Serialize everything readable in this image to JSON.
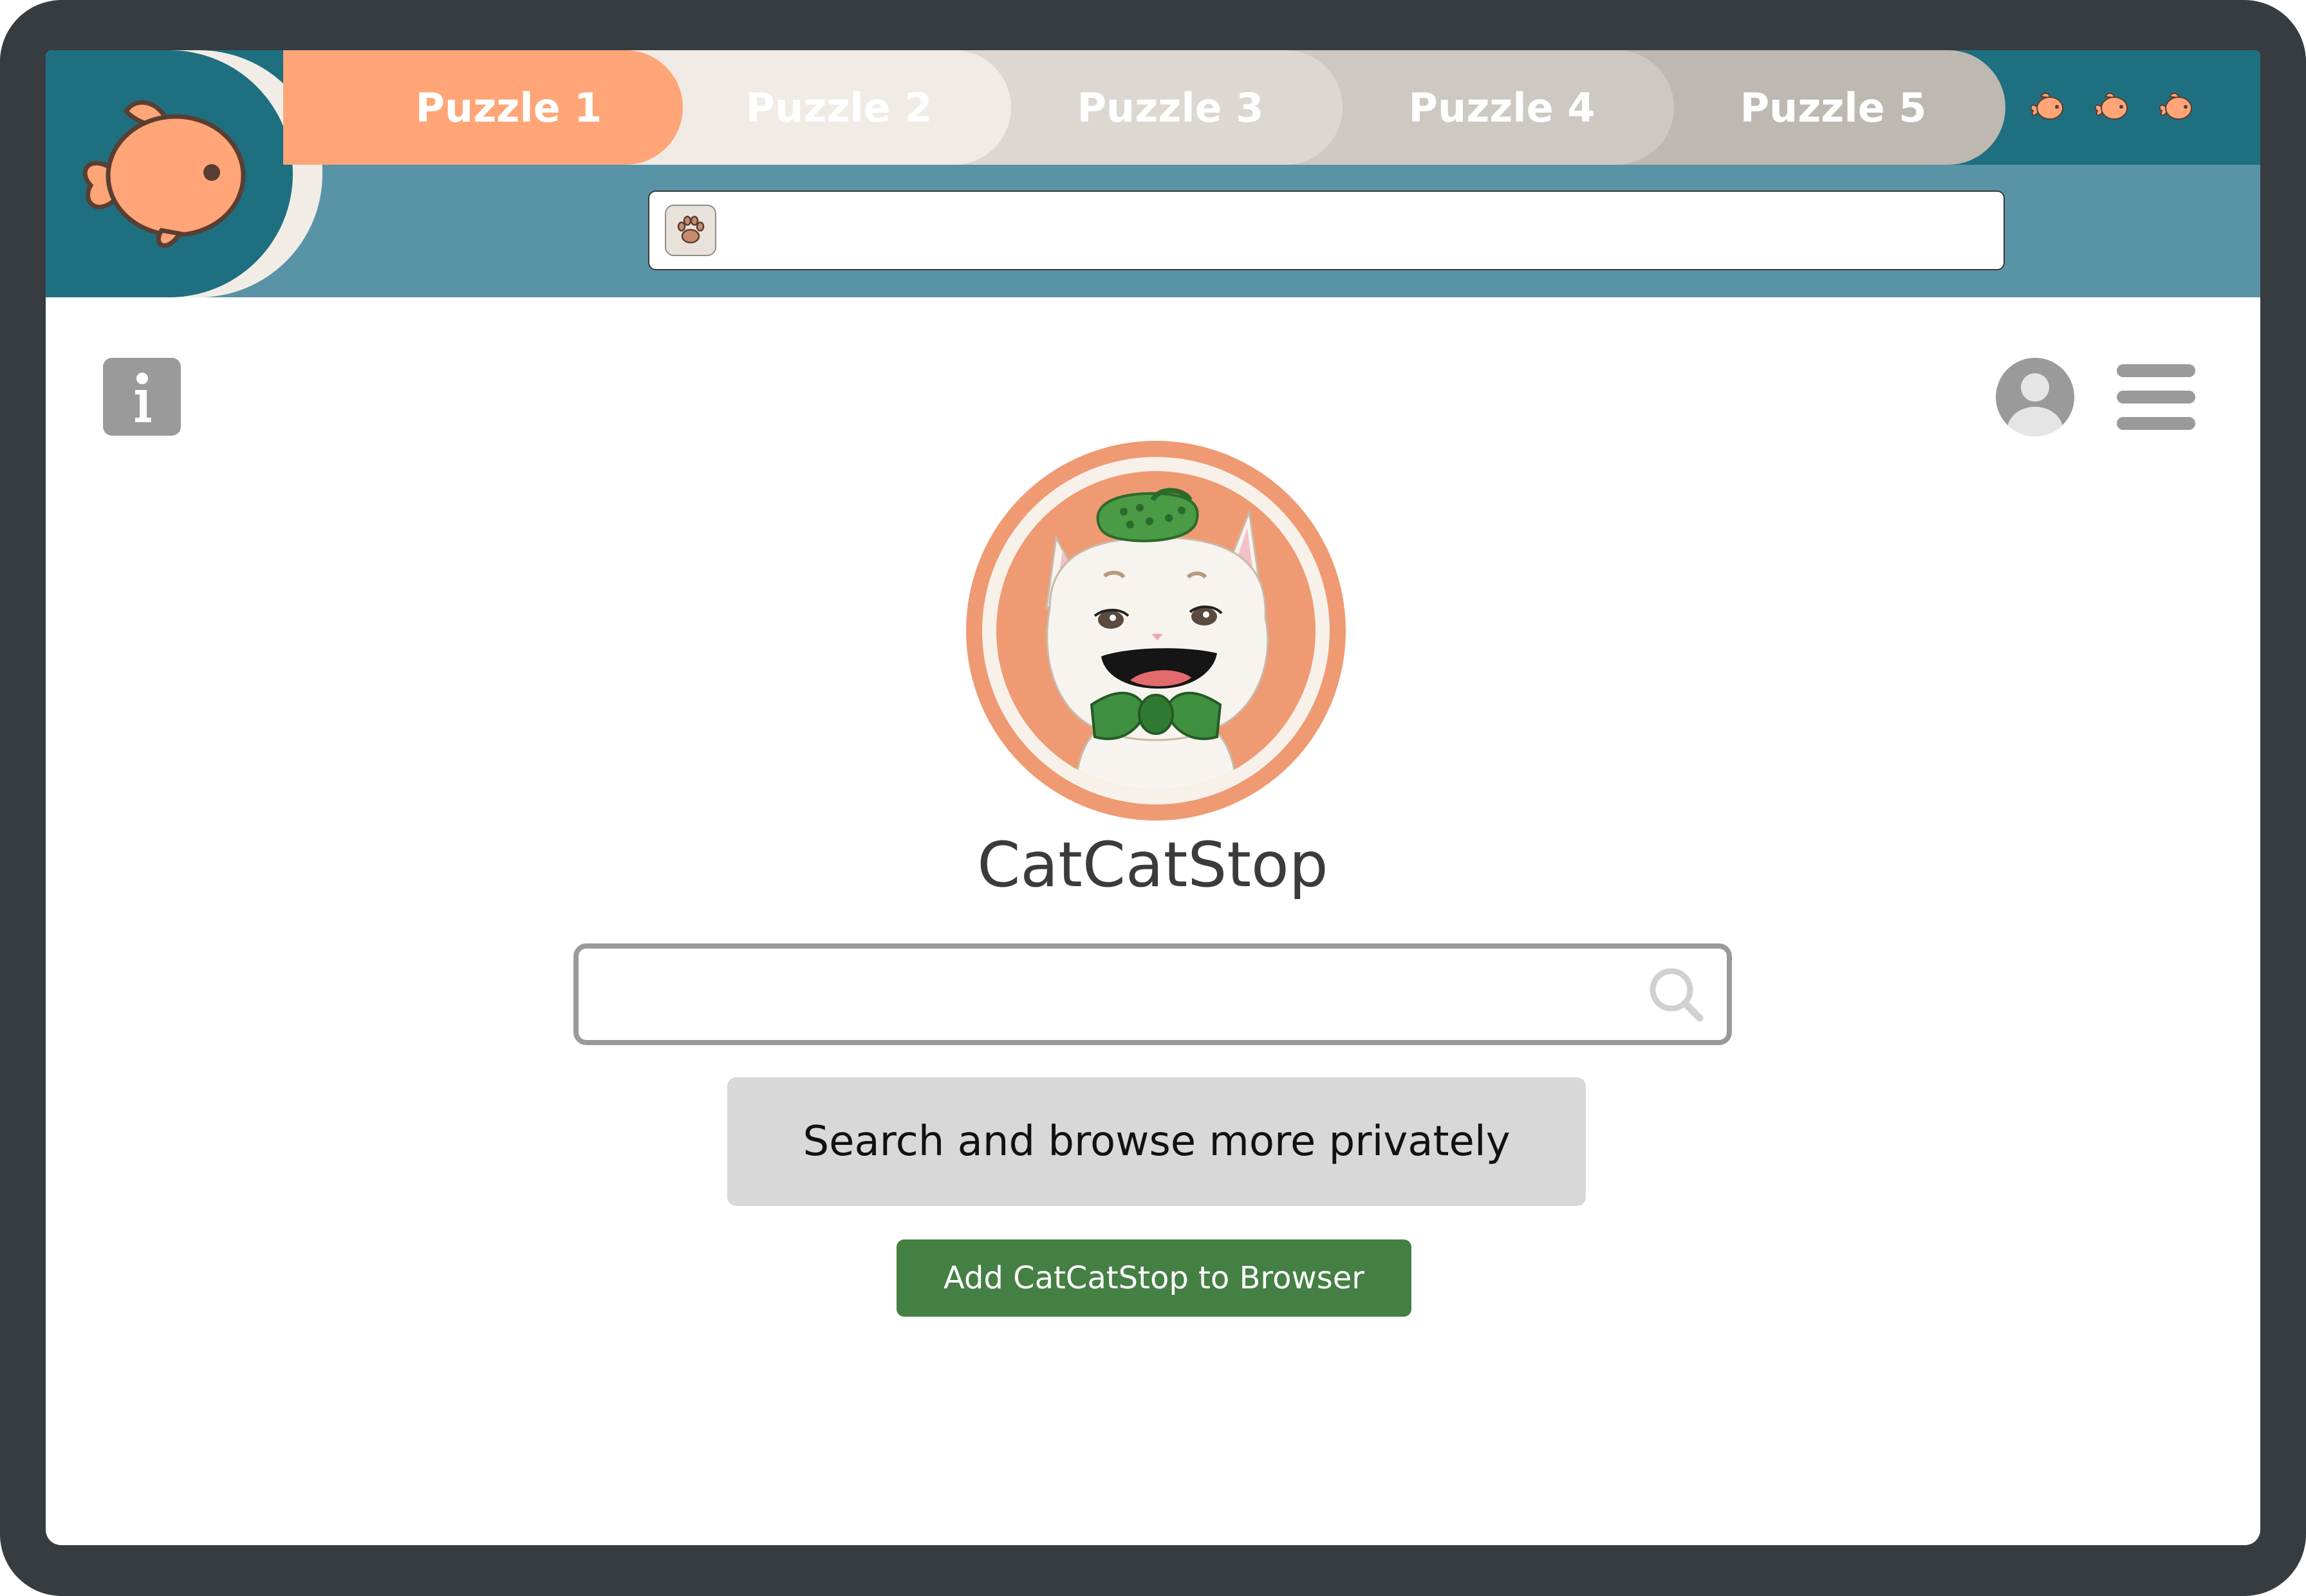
{
  "theme": {
    "frame": "#363c40",
    "chrome_top": "#1e6f7f",
    "chrome_bottom": "#5993a6",
    "accent_orange": "#ffa577",
    "tab_colors": [
      "#ffa577",
      "#f0ebe4",
      "#dcd7d1",
      "#cdc8c2",
      "#bdb8b1"
    ],
    "add_button": "#447f43"
  },
  "logo": {
    "icon": "goldfish-icon"
  },
  "tabs": [
    {
      "label": "Puzzle 1",
      "active": true
    },
    {
      "label": "Puzzle 2",
      "active": false
    },
    {
      "label": "Puzzle 3",
      "active": false
    },
    {
      "label": "Puzzle 4",
      "active": false
    },
    {
      "label": "Puzzle 5",
      "active": false
    }
  ],
  "lives": {
    "count": 3,
    "icon": "fish-icon"
  },
  "address_bar": {
    "value": "",
    "site_icon": "paw-icon"
  },
  "toolbar": {
    "info_icon": "info-icon",
    "account_icon": "user-avatar-icon",
    "menu_icon": "hamburger-menu-icon"
  },
  "site": {
    "logo": "cat-with-croc-hat-and-bowtie-logo",
    "name": "CatCatStop"
  },
  "search": {
    "value": "",
    "placeholder": "",
    "icon": "search-icon"
  },
  "buttons": {
    "private_label": "Search and browse more privately",
    "add_label": "Add CatCatStop to Browser"
  }
}
